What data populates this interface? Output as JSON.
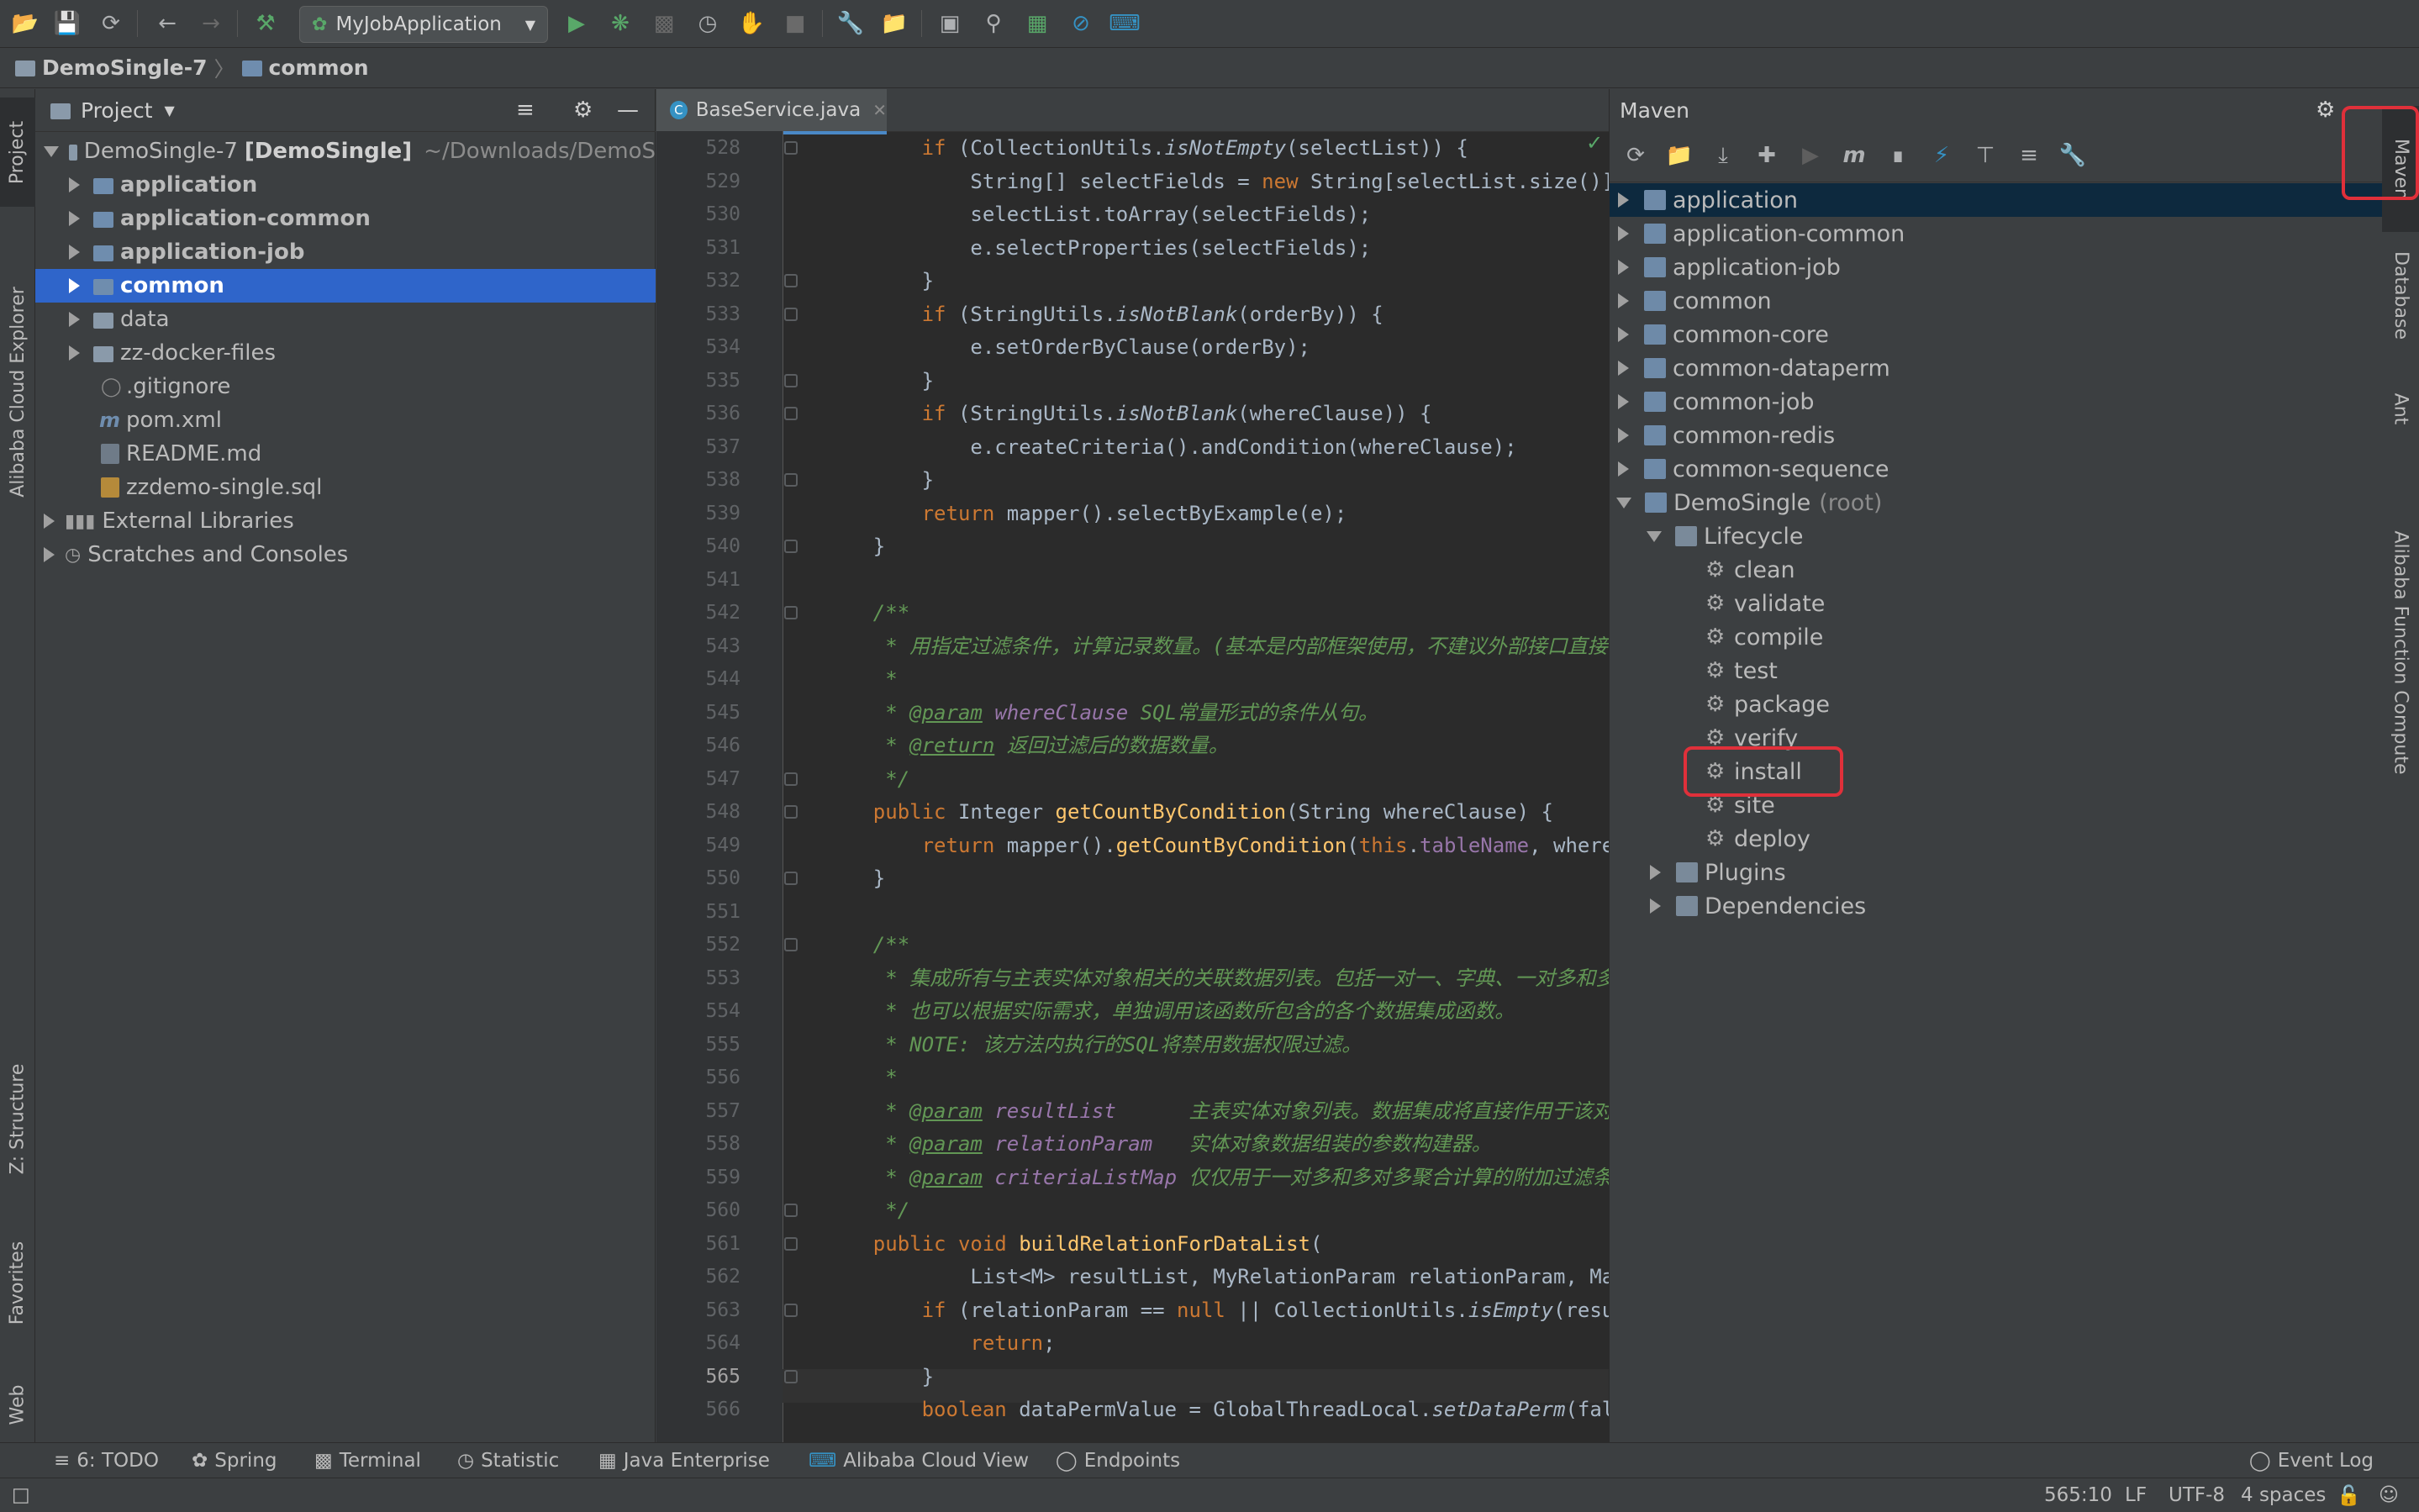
{
  "toolbar": {
    "run_config": "MyJobApplication",
    "icons": [
      "open-icon",
      "save-icon",
      "sync-icon",
      "back-icon",
      "forward-icon",
      "build-icon",
      "run-icon",
      "debug-icon",
      "coverage-icon",
      "profile-icon",
      "attach-icon",
      "stop-icon",
      "settings-icon",
      "project-structure-icon",
      "frame-icon",
      "search-icon",
      "profiler-icon",
      "disable-icon",
      "cloud-icon"
    ]
  },
  "breadcrumb": {
    "project": "DemoSingle-7",
    "module": "common"
  },
  "left_stripe": {
    "project": "Project",
    "alibaba": "Alibaba Cloud Explorer",
    "structure": "Z: Structure",
    "favorites": "Favorites",
    "web": "Web"
  },
  "project_panel": {
    "title": "Project",
    "root_name": "DemoSingle-7",
    "root_module": "[DemoSingle]",
    "root_path": "~/Downloads/DemoS",
    "children": [
      "application",
      "application-common",
      "application-job",
      "common",
      "data",
      "zz-docker-files",
      ".gitignore",
      "pom.xml",
      "README.md",
      "zzdemo-single.sql"
    ],
    "external": "External Libraries",
    "scratches": "Scratches and Consoles"
  },
  "editor": {
    "tab": "BaseService.java",
    "cursor_line": "565",
    "lines": [
      {
        "n": "528",
        "c": "        if (CollectionUtils.isNotEmpty(selectList)) {"
      },
      {
        "n": "529",
        "c": "            String[] selectFields = new String[selectList.size()];"
      },
      {
        "n": "530",
        "c": "            selectList.toArray(selectFields);"
      },
      {
        "n": "531",
        "c": "            e.selectProperties(selectFields);"
      },
      {
        "n": "532",
        "c": "        }"
      },
      {
        "n": "533",
        "c": "        if (StringUtils.isNotBlank(orderBy)) {"
      },
      {
        "n": "534",
        "c": "            e.setOrderByClause(orderBy);"
      },
      {
        "n": "535",
        "c": "        }"
      },
      {
        "n": "536",
        "c": "        if (StringUtils.isNotBlank(whereClause)) {"
      },
      {
        "n": "537",
        "c": "            e.createCriteria().andCondition(whereClause);"
      },
      {
        "n": "538",
        "c": "        }"
      },
      {
        "n": "539",
        "c": "        return mapper().selectByExample(e);"
      },
      {
        "n": "540",
        "c": "    }"
      },
      {
        "n": "541",
        "c": ""
      },
      {
        "n": "542",
        "c": "    /**"
      },
      {
        "n": "543",
        "c": "     * 用指定过滤条件，计算记录数量。(基本是内部框架使用，不建议外部接口直接使"
      },
      {
        "n": "544",
        "c": "     *"
      },
      {
        "n": "545",
        "c": "     * @param whereClause SQL常量形式的条件从句。"
      },
      {
        "n": "546",
        "c": "     * @return 返回过滤后的数据数量。"
      },
      {
        "n": "547",
        "c": "     */"
      },
      {
        "n": "548",
        "c": "    public Integer getCountByCondition(String whereClause) {"
      },
      {
        "n": "549",
        "c": "        return mapper().getCountByCondition(this.tableName, whereClau"
      },
      {
        "n": "550",
        "c": "    }"
      },
      {
        "n": "551",
        "c": ""
      },
      {
        "n": "552",
        "c": "    /**"
      },
      {
        "n": "553",
        "c": "     * 集成所有与主表实体对象相关的关联数据列表。包括一对一、字典、一对多和多对"
      },
      {
        "n": "554",
        "c": "     * 也可以根据实际需求，单独调用该函数所包含的各个数据集成函数。"
      },
      {
        "n": "555",
        "c": "     * NOTE: 该方法内执行的SQL将禁用数据权限过滤。"
      },
      {
        "n": "556",
        "c": "     *"
      },
      {
        "n": "557",
        "c": "     * @param resultList      主表实体对象列表。数据集成将直接作用于该对象列"
      },
      {
        "n": "558",
        "c": "     * @param relationParam   实体对象数据组装的参数构建器。"
      },
      {
        "n": "559",
        "c": "     * @param criteriaListMap 仅仅用于一对多和多对多聚合计算的附加过滤条件。"
      },
      {
        "n": "560",
        "c": "     */"
      },
      {
        "n": "561",
        "c": "    public void buildRelationForDataList("
      },
      {
        "n": "562",
        "c": "            List<M> resultList, MyRelationParam relationParam, Map<St"
      },
      {
        "n": "563",
        "c": "        if (relationParam == null || CollectionUtils.isEmpty(resultLi"
      },
      {
        "n": "564",
        "c": "            return;"
      },
      {
        "n": "565",
        "c": "        }"
      },
      {
        "n": "566",
        "c": "        boolean dataPermValue = GlobalThreadLocal.setDataPerm(false);"
      }
    ]
  },
  "maven": {
    "title": "Maven",
    "modules": [
      "application",
      "application-common",
      "application-job",
      "common",
      "common-core",
      "common-dataperm",
      "common-job",
      "common-redis",
      "common-sequence"
    ],
    "root_name": "DemoSingle",
    "root_tag": "(root)",
    "lifecycle_label": "Lifecycle",
    "lifecycle": [
      "clean",
      "validate",
      "compile",
      "test",
      "package",
      "verify",
      "install",
      "site",
      "deploy"
    ],
    "plugins": "Plugins",
    "dependencies": "Dependencies"
  },
  "right_stripe": {
    "maven": "Maven",
    "database": "Database",
    "ant": "Ant",
    "function_compute": "Alibaba Function Compute"
  },
  "bottom_tools": {
    "todo": "6: TODO",
    "spring": "Spring",
    "terminal": "Terminal",
    "statistic": "Statistic",
    "java_enterprise": "Java Enterprise",
    "alibaba_view": "Alibaba Cloud View",
    "endpoints": "Endpoints",
    "event_log": "Event Log"
  },
  "status": {
    "position": "565:10",
    "line_sep": "LF",
    "encoding": "UTF-8",
    "indent": "4 spaces"
  },
  "colors": {
    "keyword": "#cc7832",
    "method": "#ffc66d",
    "comment": "#629755",
    "field": "#9876aa",
    "highlight_box": "#e0303a",
    "selection": "#2f65ca"
  }
}
